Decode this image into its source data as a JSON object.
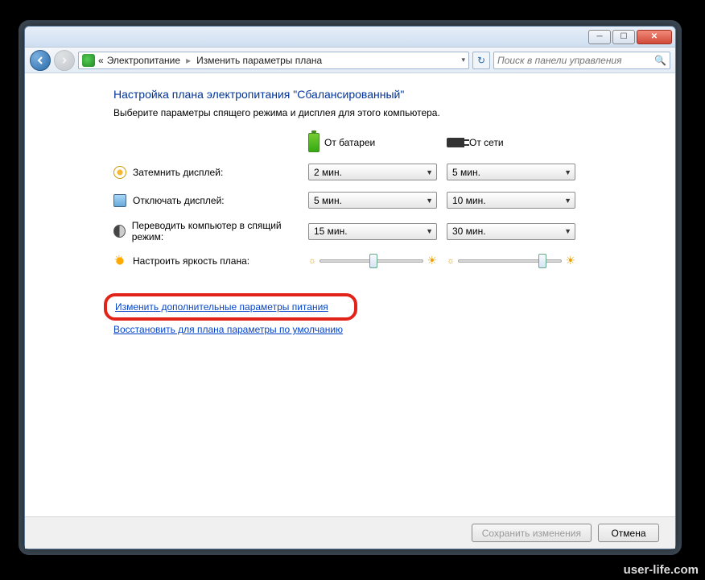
{
  "titlebar": {
    "minimize": "─",
    "maximize": "☐",
    "close": "✕"
  },
  "nav": {
    "breadcrumb_prefix": "«",
    "breadcrumb1": "Электропитание",
    "breadcrumb2": "Изменить параметры плана",
    "search_placeholder": "Поиск в панели управления"
  },
  "heading": "Настройка плана электропитания \"Сбалансированный\"",
  "subtitle": "Выберите параметры спящего режима и дисплея для этого компьютера.",
  "columns": {
    "battery": "От батареи",
    "ac": "От сети"
  },
  "rows": {
    "dim": {
      "label": "Затемнить дисплей:",
      "battery": "2 мин.",
      "ac": "5 мин."
    },
    "off": {
      "label": "Отключать дисплей:",
      "battery": "5 мин.",
      "ac": "10 мин."
    },
    "sleep": {
      "label": "Переводить компьютер в спящий режим:",
      "battery": "15 мин.",
      "ac": "30 мин."
    },
    "bright": {
      "label": "Настроить яркость плана:"
    }
  },
  "links": {
    "advanced": "Изменить дополнительные параметры питания",
    "restore": "Восстановить для плана параметры по умолчанию"
  },
  "buttons": {
    "save": "Сохранить изменения",
    "cancel": "Отмена"
  },
  "watermark": "user-life.com"
}
